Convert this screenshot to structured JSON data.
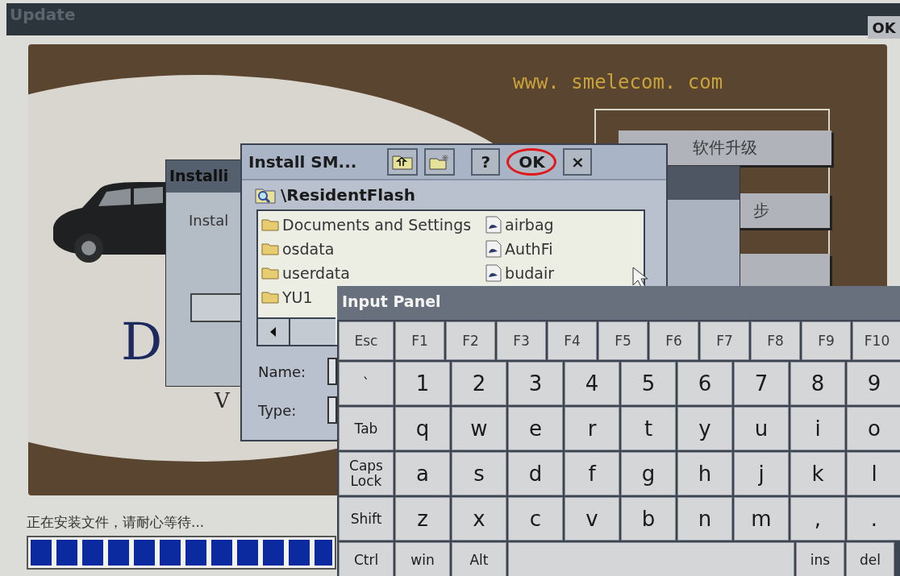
{
  "update_window": {
    "title": "Update",
    "ok_button": "OK"
  },
  "artwork": {
    "website": "www. smelecom. com",
    "logo_fragments": [
      "D",
      "V"
    ],
    "menu_buttons": [
      {
        "label": "软件升级"
      },
      {
        "label": "步"
      }
    ]
  },
  "status": {
    "message": "正在安装文件，请耐心等待...",
    "level": 1
  },
  "install_window": {
    "title": "Installi",
    "label": "Instal"
  },
  "file_dialog": {
    "title": "Install SM...",
    "toolbar": [
      {
        "kind": "up-folder",
        "circled": false
      },
      {
        "kind": "new-folder",
        "circled": false
      },
      {
        "kind": "text",
        "label": "?",
        "circled": false
      },
      {
        "kind": "text",
        "label": "OK",
        "circled": true
      },
      {
        "kind": "text",
        "label": "×",
        "circled": false
      }
    ],
    "path": "\\ResidentFlash",
    "folders": [
      "Documents and Settings",
      "osdata",
      "userdata",
      "YU1"
    ],
    "files": [
      "airbag",
      "AuthFi",
      "budair"
    ],
    "fields": [
      {
        "label": "Name:"
      },
      {
        "label": "Type:"
      }
    ]
  },
  "input_panel": {
    "title": "Input Panel",
    "rows": [
      [
        "Esc",
        "F1",
        "F2",
        "F3",
        "F4",
        "F5",
        "F6",
        "F7",
        "F8",
        "F9",
        "F10"
      ],
      [
        "`",
        "1",
        "2",
        "3",
        "4",
        "5",
        "6",
        "7",
        "8",
        "9"
      ],
      [
        "Tab",
        "q",
        "w",
        "e",
        "r",
        "t",
        "y",
        "u",
        "i",
        "o"
      ],
      [
        "Caps Lock",
        "a",
        "s",
        "d",
        "f",
        "g",
        "h",
        "j",
        "k",
        "l"
      ],
      [
        "Shift",
        "z",
        "x",
        "c",
        "v",
        "b",
        "n",
        "m",
        ",",
        "."
      ]
    ],
    "bottom_left": [
      "Ctrl",
      "win",
      "Alt"
    ],
    "bottom_right": [
      "ins",
      "del"
    ]
  }
}
